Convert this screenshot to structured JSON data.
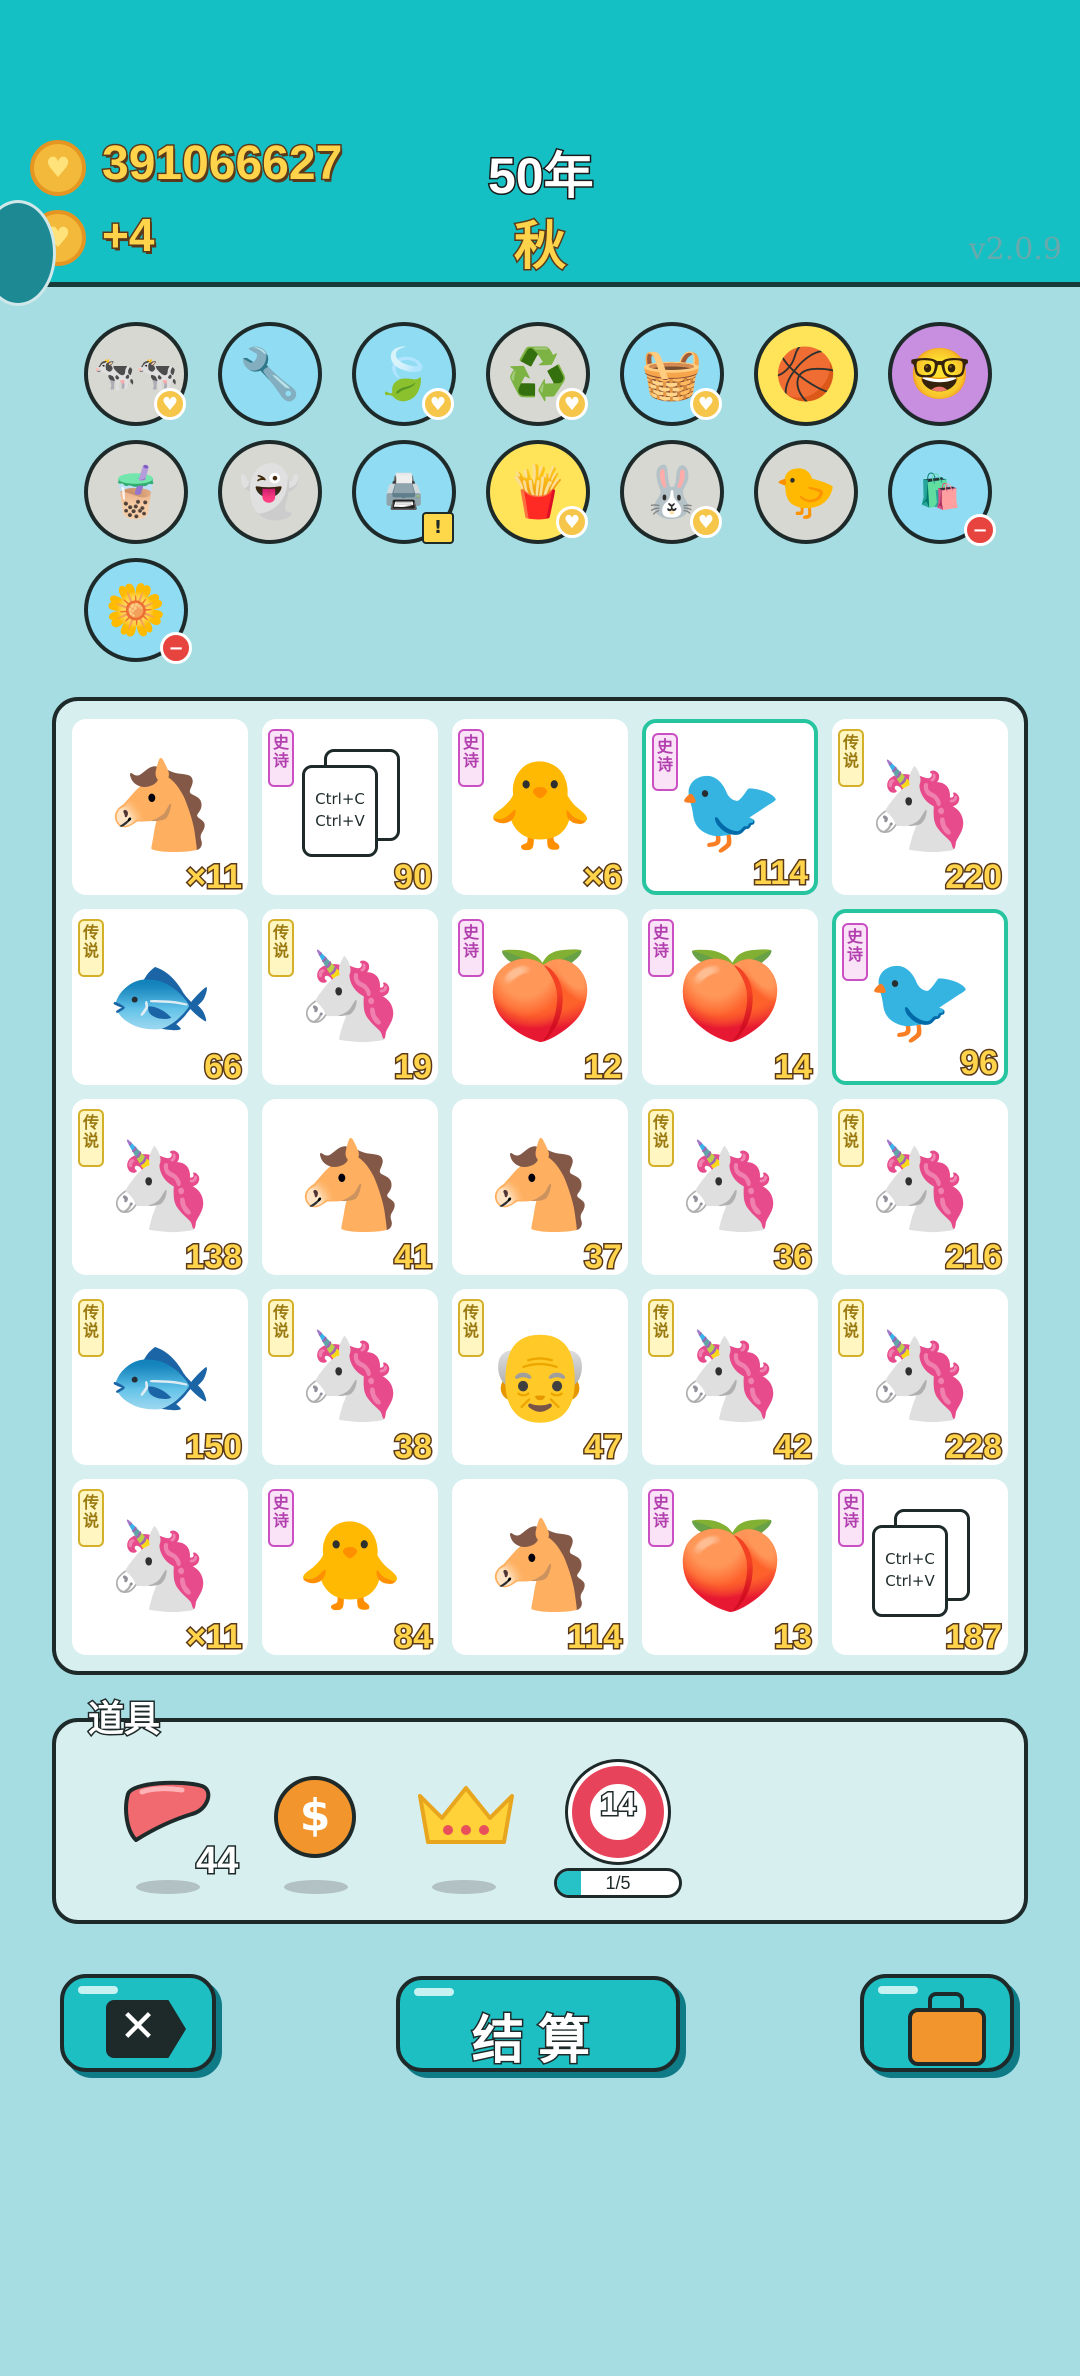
{
  "header": {
    "coins": "391066627",
    "income": "+4",
    "year": "50年",
    "season": "秋",
    "version": "v2.0.9"
  },
  "items_row1": [
    {
      "name": "cows",
      "icon": "🐄🐄",
      "bg": "gray",
      "badge": "heart"
    },
    {
      "name": "pump",
      "icon": "🔧",
      "bg": "blue",
      "badge": ""
    },
    {
      "name": "leaf",
      "icon": "🍃",
      "bg": "blue",
      "badge": "heart"
    },
    {
      "name": "recycle",
      "icon": "♻️",
      "bg": "gray",
      "badge": "heart"
    },
    {
      "name": "fruit-basket",
      "icon": "🧺",
      "bg": "blue",
      "badge": "heart"
    },
    {
      "name": "basketballs",
      "icon": "🏀",
      "bg": "yellow",
      "badge": ""
    },
    {
      "name": "math-nerd",
      "icon": "🤓",
      "bg": "purple",
      "badge": ""
    }
  ],
  "items_row2": [
    {
      "name": "bubble-tea",
      "icon": "🧋",
      "bg": "gray",
      "badge": ""
    },
    {
      "name": "ghost",
      "icon": "👻",
      "bg": "gray",
      "badge": ""
    },
    {
      "name": "printer",
      "icon": "🖨️",
      "bg": "blue",
      "badge": "warn"
    },
    {
      "name": "fries",
      "icon": "🍟",
      "bg": "yellow",
      "badge": "heart"
    },
    {
      "name": "rabbit",
      "icon": "🐰",
      "bg": "gray",
      "badge": "heart"
    },
    {
      "name": "chick-egg",
      "icon": "🐤",
      "bg": "gray",
      "badge": ""
    },
    {
      "name": "trash-bag",
      "icon": "🛍️",
      "bg": "blue",
      "badge": "minus"
    }
  ],
  "items_row3": [
    {
      "name": "flower-pot",
      "icon": "🌼",
      "bg": "blue",
      "badge": "minus"
    }
  ],
  "grid": [
    {
      "icon": "🐴",
      "tag": "",
      "count": "×11",
      "selected": false
    },
    {
      "icon": "ctrl",
      "tag": "史诗",
      "count": "90",
      "selected": false
    },
    {
      "icon": "🐥",
      "tag": "史诗",
      "count": "×6",
      "selected": false
    },
    {
      "icon": "🐦",
      "tag": "史诗",
      "count": "114",
      "selected": true
    },
    {
      "icon": "🦄",
      "tag": "传说",
      "count": "220",
      "selected": false
    },
    {
      "icon": "🐟",
      "tag": "传说",
      "count": "66",
      "selected": false
    },
    {
      "icon": "🦄",
      "tag": "传说",
      "count": "19",
      "selected": false
    },
    {
      "icon": "🍑",
      "tag": "史诗",
      "count": "12",
      "selected": false
    },
    {
      "icon": "🍑",
      "tag": "史诗",
      "count": "14",
      "selected": false
    },
    {
      "icon": "🐦",
      "tag": "史诗",
      "count": "96",
      "selected": true
    },
    {
      "icon": "🦄",
      "tag": "传说",
      "count": "138",
      "selected": false
    },
    {
      "icon": "🐴",
      "tag": "",
      "count": "41",
      "selected": false
    },
    {
      "icon": "🐴",
      "tag": "",
      "count": "37",
      "selected": false
    },
    {
      "icon": "🦄",
      "tag": "传说",
      "count": "36",
      "selected": false
    },
    {
      "icon": "🦄",
      "tag": "传说",
      "count": "216",
      "selected": false
    },
    {
      "icon": "🐟",
      "tag": "传说",
      "count": "150",
      "selected": false
    },
    {
      "icon": "🦄",
      "tag": "传说",
      "count": "38",
      "selected": false
    },
    {
      "icon": "👴",
      "tag": "传说",
      "count": "47",
      "selected": false
    },
    {
      "icon": "🦄",
      "tag": "传说",
      "count": "42",
      "selected": false
    },
    {
      "icon": "🦄",
      "tag": "传说",
      "count": "228",
      "selected": false
    },
    {
      "icon": "🦄",
      "tag": "传说",
      "count": "×11",
      "selected": false
    },
    {
      "icon": "🐥",
      "tag": "史诗",
      "count": "84",
      "selected": false
    },
    {
      "icon": "🐴",
      "tag": "",
      "count": "114",
      "selected": false
    },
    {
      "icon": "🍑",
      "tag": "史诗",
      "count": "13",
      "selected": false
    },
    {
      "icon": "ctrl",
      "tag": "史诗",
      "count": "187",
      "selected": false
    }
  ],
  "ctrl_card": {
    "line1": "Ctrl+C",
    "line2": "Ctrl+V"
  },
  "tools": {
    "title": "道具",
    "liver_count": "44",
    "target_value": "14",
    "target_progress": "1/5",
    "target_progress_fraction": 0.2
  },
  "buttons": {
    "settle_label": "结算"
  }
}
